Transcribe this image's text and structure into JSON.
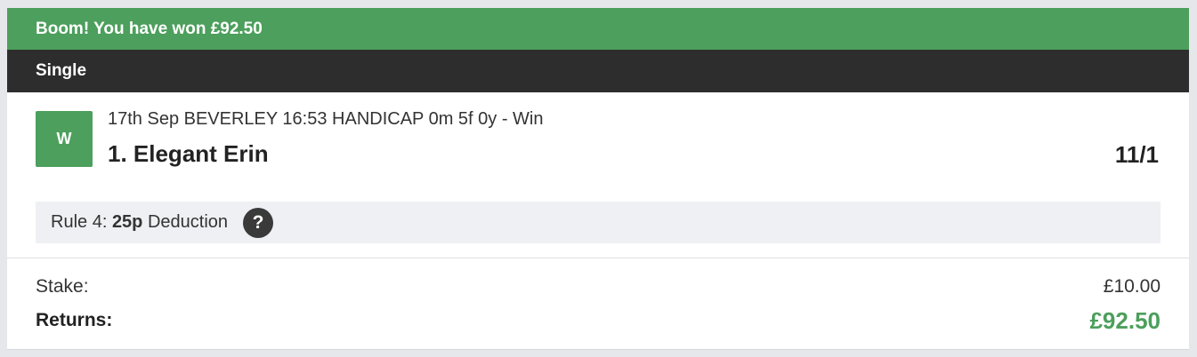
{
  "banner": {
    "message": "Boom! You have won £92.50"
  },
  "bet": {
    "type": "Single"
  },
  "selection": {
    "result_badge": "W",
    "event_description": "17th Sep BEVERLEY 16:53 HANDICAP 0m 5f 0y - Win",
    "runner": "1. Elegant Erin",
    "odds": "11/1",
    "rule4": {
      "prefix": "Rule 4:",
      "amount": "25p",
      "suffix": "Deduction",
      "help_icon": "?"
    }
  },
  "totals": {
    "stake_label": "Stake:",
    "stake_value": "£10.00",
    "returns_label": "Returns:",
    "returns_value": "£92.50"
  },
  "colors": {
    "win_green": "#4c9f5c",
    "header_dark": "#2d2d2d",
    "rule4_bg": "#eef0f3"
  }
}
